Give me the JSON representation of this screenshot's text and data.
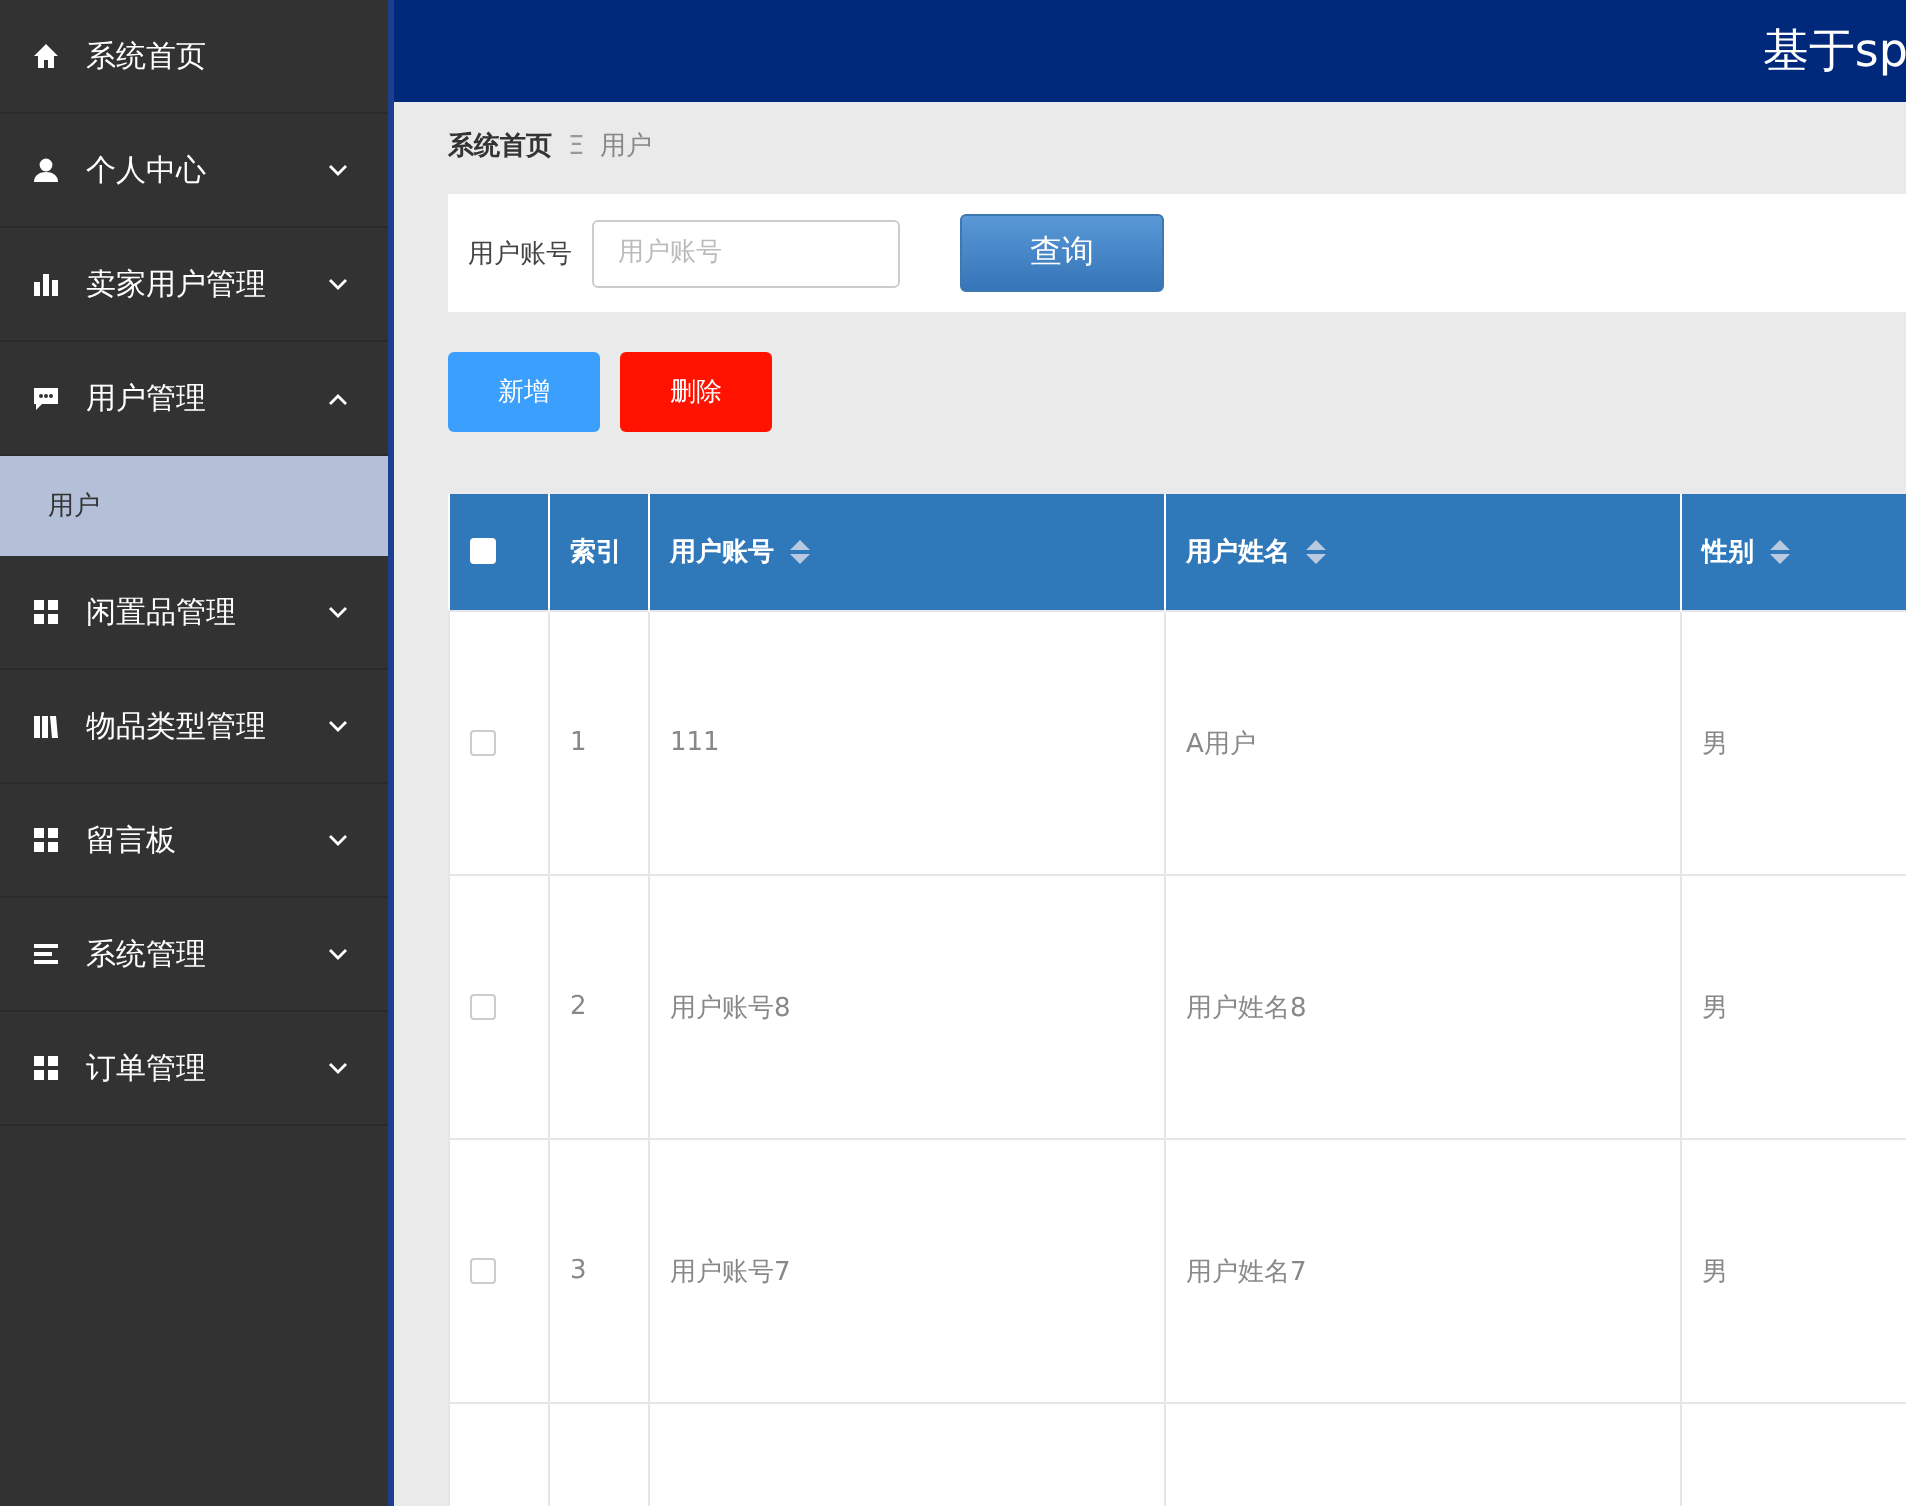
{
  "sidebar": {
    "items": [
      {
        "label": "系统首页"
      },
      {
        "label": "个人中心",
        "expanded": false
      },
      {
        "label": "卖家用户管理",
        "expanded": false
      },
      {
        "label": "用户管理",
        "expanded": true,
        "children": [
          {
            "label": "用户",
            "selected": true
          }
        ]
      },
      {
        "label": "闲置品管理",
        "expanded": false
      },
      {
        "label": "物品类型管理",
        "expanded": false
      },
      {
        "label": "留言板",
        "expanded": false
      },
      {
        "label": "系统管理",
        "expanded": false
      },
      {
        "label": "订单管理",
        "expanded": false
      }
    ]
  },
  "header": {
    "title": "基于sp"
  },
  "breadcrumb": {
    "items": [
      "系统首页",
      "用户"
    ],
    "separator": "Ξ"
  },
  "search": {
    "label": "用户账号",
    "placeholder": "用户账号",
    "button": "查询"
  },
  "actions": [
    {
      "label": "新增",
      "kind": "add"
    },
    {
      "label": "删除",
      "kind": "delete"
    }
  ],
  "table": {
    "select_all": {
      "checked": false
    },
    "columns": [
      {
        "label": "索引",
        "sortable": false
      },
      {
        "label": "用户账号",
        "sortable": true
      },
      {
        "label": "用户姓名",
        "sortable": true
      },
      {
        "label": "性别",
        "sortable": true
      }
    ],
    "rows": [
      {
        "checked": false,
        "cells": [
          "1",
          "111",
          "A用户",
          "男"
        ]
      },
      {
        "checked": false,
        "cells": [
          "2",
          "用户账号8",
          "用户姓名8",
          "男"
        ]
      },
      {
        "checked": false,
        "cells": [
          "3",
          "用户账号7",
          "用户姓名7",
          "男"
        ]
      }
    ]
  }
}
